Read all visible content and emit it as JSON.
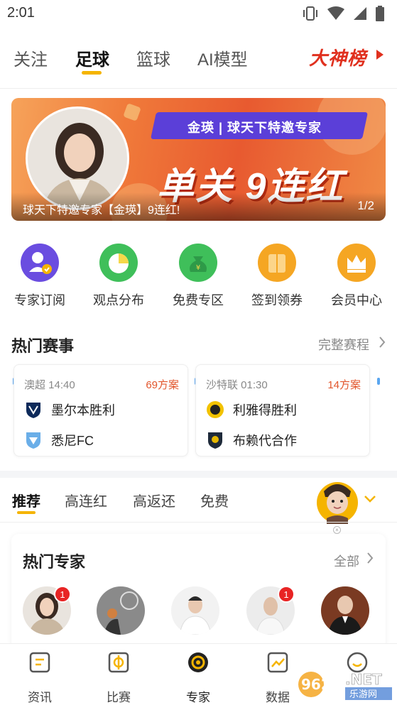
{
  "status_bar": {
    "time": "2:01"
  },
  "top_tabs": {
    "items": [
      "关注",
      "足球",
      "篮球",
      "AI模型"
    ],
    "active": "足球",
    "rank_label": "大神榜"
  },
  "banner": {
    "ribbon": "金瑛 | 球天下特邀专家",
    "headline": "单关 9连红",
    "caption": "球天下特邀专家【金瑛】9连红!",
    "page": "1/2"
  },
  "quick_entries": [
    {
      "label": "专家订阅",
      "icon": "user-check-icon",
      "color": "#6a4de0"
    },
    {
      "label": "观点分布",
      "icon": "pie-chart-icon",
      "color": "#3fbf5a"
    },
    {
      "label": "免费专区",
      "icon": "money-bag-icon",
      "color": "#3fbf5a"
    },
    {
      "label": "签到领券",
      "icon": "coupon-icon",
      "color": "#f5a623"
    },
    {
      "label": "会员中心",
      "icon": "crown-icon",
      "color": "#f5a623"
    }
  ],
  "hot_matches": {
    "title": "热门赛事",
    "more_label": "完整赛程",
    "matches": [
      {
        "league_time": "澳超 14:40",
        "plans": "69方案",
        "home": "墨尔本胜利",
        "away": "悉尼FC"
      },
      {
        "league_time": "沙特联 01:30",
        "plans": "14方案",
        "home": "利雅得胜利",
        "away": "布赖代合作"
      }
    ]
  },
  "sub_tabs": {
    "items": [
      "推荐",
      "高连红",
      "高返还",
      "免费"
    ],
    "active": "推荐"
  },
  "experts": {
    "title": "热门专家",
    "more_label": "全部",
    "badges": [
      "1",
      "1"
    ]
  },
  "bottom_nav": {
    "items": [
      "资讯",
      "比赛",
      "专家",
      "数据",
      ""
    ],
    "active": "专家"
  },
  "colors": {
    "accent": "#f5b400",
    "rank_red": "#e0301e",
    "plans_orange": "#e2562c",
    "banner_purple": "#5b3fd8"
  },
  "watermark": "962.NET 乐游网"
}
